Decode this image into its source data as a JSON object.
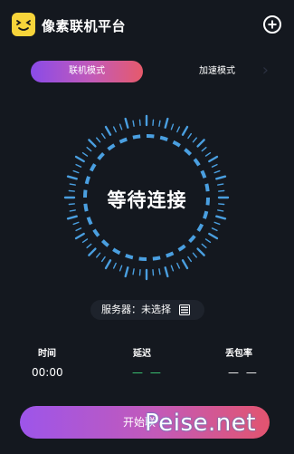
{
  "header": {
    "app_title": "像素联机平台",
    "logo_icon": "smiley-face-icon",
    "add_icon": "add-circle-icon"
  },
  "tabs": {
    "active": "联机模式",
    "inactive": "加速模式"
  },
  "dial": {
    "status": "等待连接",
    "accent": "#4a9fe0"
  },
  "server": {
    "label": "服务器：未选择",
    "icon": "server-list-icon"
  },
  "stats": {
    "time_label": "时间",
    "time_value": "00:00",
    "latency_label": "延迟",
    "latency_value": "— —",
    "loss_label": "丢包率",
    "loss_value": "— —"
  },
  "bottom": {
    "start_label": "开始联"
  },
  "watermark": {
    "text": "Peise.net"
  },
  "colors": {
    "background": "#14181f",
    "gradient_start": "#8a4be8",
    "gradient_end": "#e65a6b",
    "latency_green": "#3ed17a"
  }
}
